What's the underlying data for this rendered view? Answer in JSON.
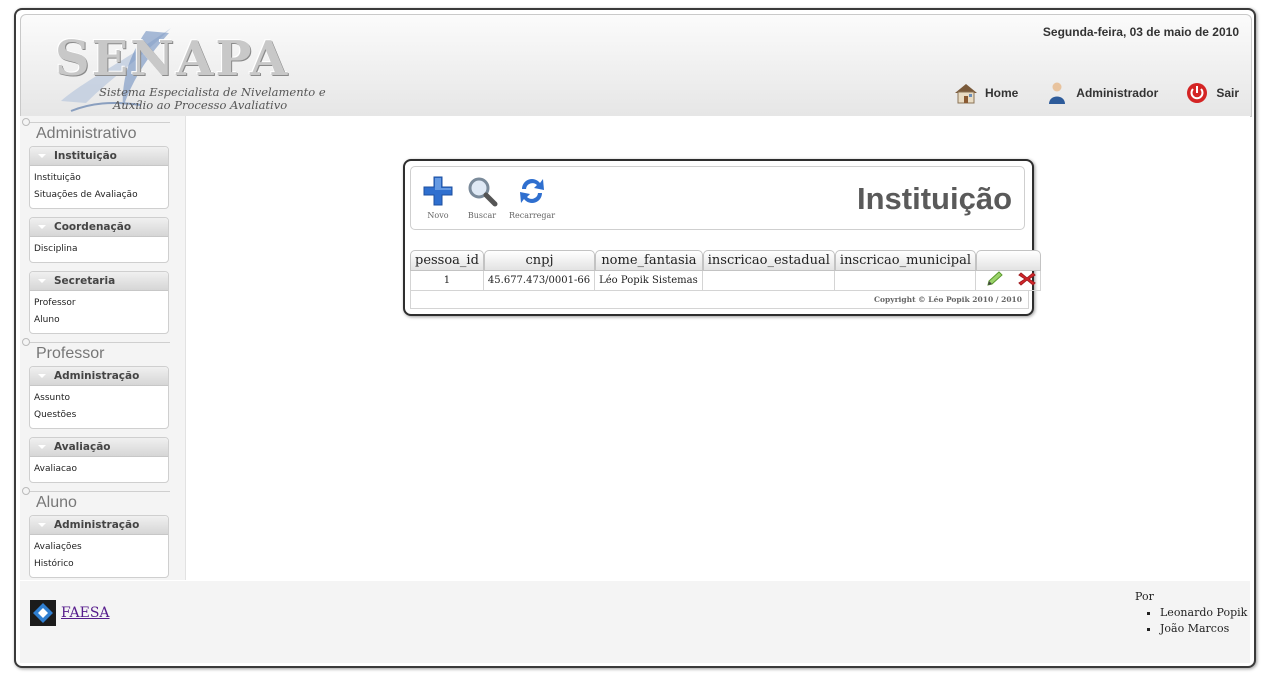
{
  "header": {
    "logo_text": "SENAPA",
    "logo_subtitle": [
      "Sistema Especialista de Nivelamento e",
      "Auxílio ao Processo Avaliativo"
    ],
    "date": "Segunda-feira, 03 de maio de 2010",
    "nav": [
      {
        "label": "Home",
        "icon": "house-icon"
      },
      {
        "label": "Administrador",
        "icon": "user-icon"
      },
      {
        "label": "Sair",
        "icon": "power-icon"
      }
    ]
  },
  "sidebar": {
    "sections": [
      {
        "title": "Administrativo",
        "groups": [
          {
            "title": "Instituição",
            "items": [
              "Instituição",
              "Situações de Avaliação"
            ]
          },
          {
            "title": "Coordenação",
            "items": [
              "Disciplina"
            ]
          },
          {
            "title": "Secretaria",
            "items": [
              "Professor",
              "Aluno"
            ]
          }
        ]
      },
      {
        "title": "Professor",
        "groups": [
          {
            "title": "Administração",
            "items": [
              "Assunto",
              "Questões"
            ]
          },
          {
            "title": "Avaliação",
            "items": [
              "Avaliacao"
            ]
          }
        ]
      },
      {
        "title": "Aluno",
        "groups": [
          {
            "title": "Administração",
            "items": [
              "Avaliações",
              "Histórico"
            ]
          }
        ]
      }
    ]
  },
  "panel": {
    "title": "Instituição",
    "toolbar": [
      {
        "label": "Novo",
        "icon": "plus-icon"
      },
      {
        "label": "Buscar",
        "icon": "magnifier-icon"
      },
      {
        "label": "Recarregar",
        "icon": "refresh-icon"
      }
    ],
    "table": {
      "columns": [
        "pessoa_id",
        "cnpj",
        "nome_fantasia",
        "inscricao_estadual",
        "inscricao_municipal",
        ""
      ],
      "rows": [
        {
          "pessoa_id": "1",
          "cnpj": "45.677.473/0001-66",
          "nome_fantasia": "Léo Popik Sistemas",
          "inscricao_estadual": "",
          "inscricao_municipal": "",
          "actions": [
            "edit-pencil-icon",
            "delete-x-icon"
          ]
        }
      ]
    },
    "copyright": "Copyright © Léo Popik 2010 / 2010"
  },
  "footer": {
    "link": "FAESA",
    "credits_label": "Por",
    "credits": [
      "Leonardo Popik",
      "João Marcos"
    ]
  },
  "colors": {
    "accent_blue": "#3a7bd5",
    "delete_red": "#d8262b",
    "power_red": "#cc1f1f"
  }
}
